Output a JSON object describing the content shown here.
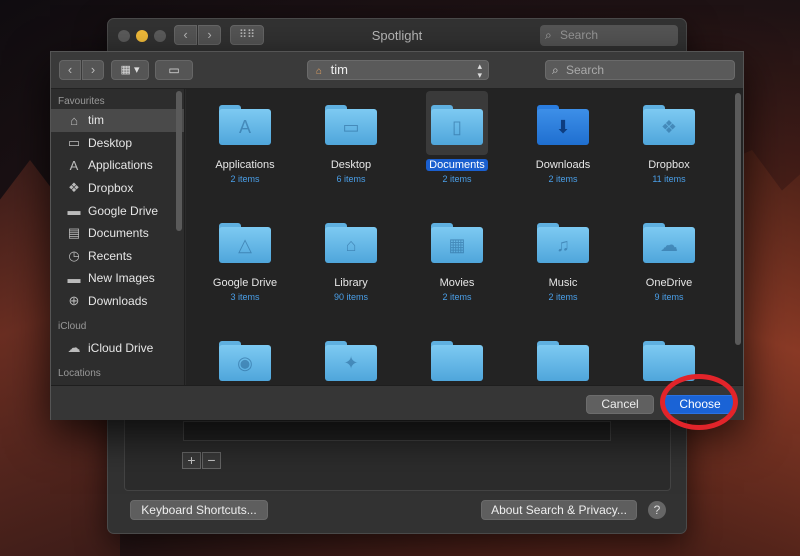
{
  "spotlight": {
    "title": "Spotlight",
    "search_placeholder": "Search",
    "keyboard_shortcuts_label": "Keyboard Shortcuts...",
    "about_label": "About Search & Privacy...",
    "help_label": "?",
    "add_label": "+",
    "remove_label": "−"
  },
  "dialog": {
    "location": "tim",
    "search_placeholder": "Search",
    "cancel_label": "Cancel",
    "choose_label": "Choose"
  },
  "sidebar": {
    "favourites_heading": "Favourites",
    "icloud_heading": "iCloud",
    "locations_heading": "Locations",
    "favourites": [
      {
        "label": "tim",
        "icon": "home-icon",
        "glyph": "⌂"
      },
      {
        "label": "Desktop",
        "icon": "desktop-icon",
        "glyph": "▭"
      },
      {
        "label": "Applications",
        "icon": "applications-icon",
        "glyph": "A"
      },
      {
        "label": "Dropbox",
        "icon": "dropbox-icon",
        "glyph": "❖"
      },
      {
        "label": "Google Drive",
        "icon": "folder-icon",
        "glyph": "▬"
      },
      {
        "label": "Documents",
        "icon": "document-icon",
        "glyph": "▤"
      },
      {
        "label": "Recents",
        "icon": "clock-icon",
        "glyph": "◷"
      },
      {
        "label": "New Images",
        "icon": "folder-icon",
        "glyph": "▬"
      },
      {
        "label": "Downloads",
        "icon": "download-icon",
        "glyph": "⊕"
      }
    ],
    "icloud": [
      {
        "label": "iCloud Drive",
        "icon": "cloud-icon",
        "glyph": "☁"
      }
    ]
  },
  "files": [
    {
      "name": "Applications",
      "count": "2 items",
      "glyph": "A",
      "icon": "applications-folder-icon"
    },
    {
      "name": "Desktop",
      "count": "6 items",
      "glyph": "▭",
      "icon": "desktop-folder-icon"
    },
    {
      "name": "Documents",
      "count": "2 items",
      "glyph": "▯",
      "icon": "documents-folder-icon"
    },
    {
      "name": "Downloads",
      "count": "2 items",
      "glyph": "⬇",
      "icon": "downloads-folder-icon"
    },
    {
      "name": "Dropbox",
      "count": "11 items",
      "glyph": "❖",
      "icon": "dropbox-folder-icon"
    },
    {
      "name": "Google Drive",
      "count": "3 items",
      "glyph": "△",
      "icon": "google-drive-folder-icon"
    },
    {
      "name": "Library",
      "count": "90 items",
      "glyph": "⌂",
      "icon": "library-folder-icon"
    },
    {
      "name": "Movies",
      "count": "2 items",
      "glyph": "▦",
      "icon": "movies-folder-icon"
    },
    {
      "name": "Music",
      "count": "2 items",
      "glyph": "♫",
      "icon": "music-folder-icon"
    },
    {
      "name": "OneDrive",
      "count": "9 items",
      "glyph": "☁",
      "icon": "onedrive-folder-icon"
    },
    {
      "name": "",
      "count": "",
      "glyph": "◉",
      "icon": "pictures-folder-icon"
    },
    {
      "name": "",
      "count": "",
      "glyph": "✦",
      "icon": "public-folder-icon"
    },
    {
      "name": "",
      "count": "",
      "glyph": "",
      "icon": "folder-icon"
    },
    {
      "name": "",
      "count": "",
      "glyph": "",
      "icon": "folder-icon"
    },
    {
      "name": "",
      "count": "",
      "glyph": "",
      "icon": "folder-icon"
    }
  ],
  "colors": {
    "accent": "#1a63d6",
    "folder": "#6ab9ea",
    "annotation": "#e2242a"
  }
}
